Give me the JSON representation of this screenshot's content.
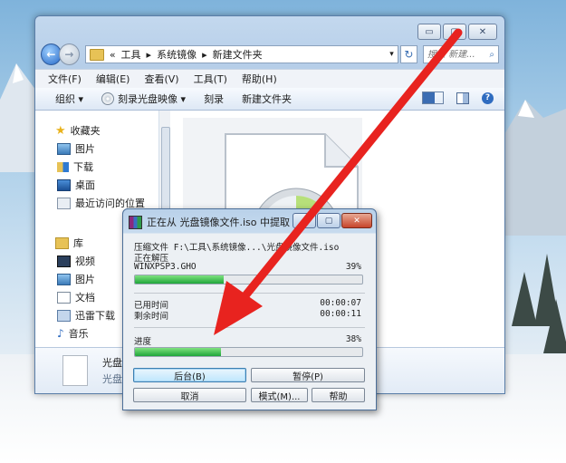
{
  "explorer": {
    "window_controls": {
      "minimize": "▭",
      "maximize": "▢",
      "close": "✕"
    },
    "address": {
      "prefix": "«",
      "crumbs": [
        "工具",
        "系统镜像",
        "新建文件夹"
      ],
      "separator": "▸",
      "dropdown": "▾",
      "refresh": "↻"
    },
    "search": {
      "placeholder": "搜索 新建...",
      "icon": "search-icon"
    },
    "menu": [
      "文件(F)",
      "编辑(E)",
      "查看(V)",
      "工具(T)",
      "帮助(H)"
    ],
    "toolbar": {
      "organize": "组织 ▾",
      "burn_image": "刻录光盘映像 ▾",
      "burn": "刻录",
      "new_folder": "新建文件夹"
    },
    "nav": {
      "favorites": "收藏夹",
      "favorites_items": [
        "图片",
        "下载",
        "桌面",
        "最近访问的位置"
      ],
      "library": "库",
      "library_items": [
        "视频",
        "图片",
        "文档",
        "迅雷下载",
        "音乐"
      ]
    },
    "details": {
      "line1": "光盘",
      "line2": "光盘"
    }
  },
  "rar": {
    "title": "正在从 光盘镜像文件.iso 中提取",
    "controls": {
      "minimize": "▁",
      "maximize": "▢",
      "close": "✕"
    },
    "archive_label": "压缩文件 F:\\工具\\系统镜像...\\光盘镜像文件.iso",
    "extracting_label": "正在解压",
    "current_file": "WINXPSP3.GHO",
    "file_percent": "39%",
    "file_progress": 0.39,
    "elapsed_label": "已用时间",
    "elapsed_value": "00:00:07",
    "remaining_label": "剩余时间",
    "remaining_value": "00:00:11",
    "progress_label": "进度",
    "total_percent": "38%",
    "total_progress": 0.38,
    "buttons": {
      "background": "后台(B)",
      "pause": "暂停(P)",
      "cancel": "取消",
      "mode": "模式(M)...",
      "help": "帮助"
    }
  },
  "colors": {
    "arrow": "#e8231f",
    "progress_fill": "#1fa53a",
    "accent": "#2467c7"
  }
}
